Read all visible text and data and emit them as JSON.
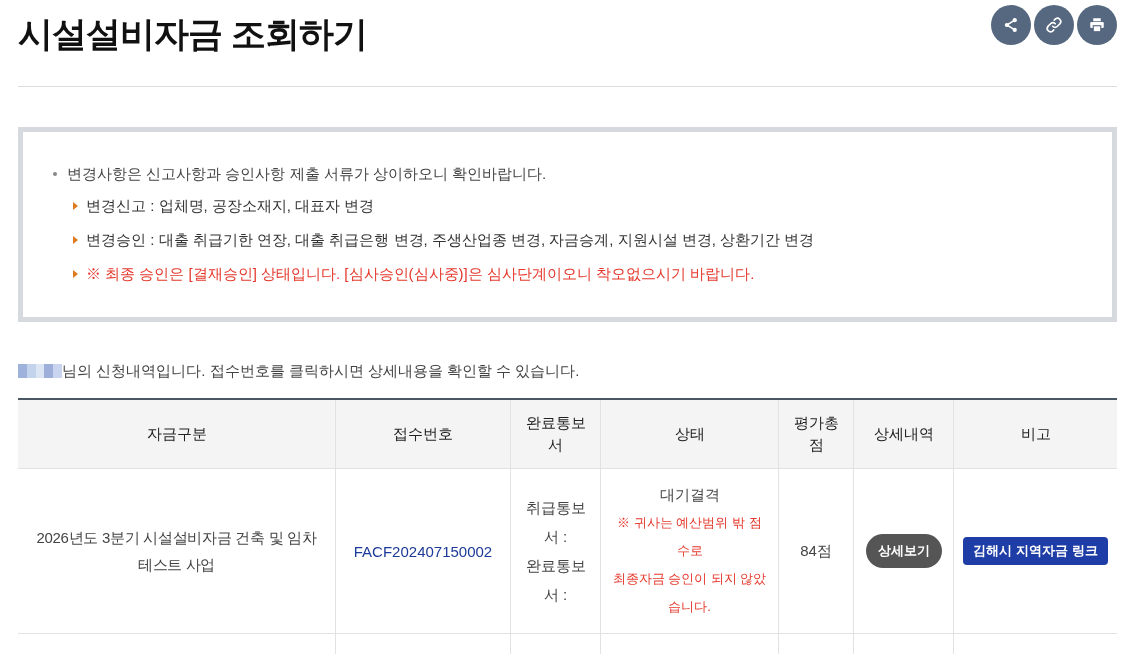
{
  "page": {
    "title": "시설설비자금 조회하기"
  },
  "notice": {
    "intro": "변경사항은 신고사항과 승인사항 제출 서류가 상이하오니 확인바랍니다.",
    "items": [
      {
        "kind": "normal",
        "text": "변경신고 : 업체명, 공장소재지, 대표자 변경"
      },
      {
        "kind": "normal",
        "text": "변경승인 : 대출 취급기한 연장, 대출 취급은행 변경, 주생산업종 변경, 자금승계, 지원시설 변경, 상환기간 변경"
      },
      {
        "kind": "warning",
        "text": "※ 최종 승인은 [결재승인] 상태입니다. [심사승인(심사중)]은 심사단계이오니 착오없으시기 바랍니다."
      }
    ]
  },
  "applicant_message": "님의 신청내역입니다. 접수번호를 클릭하시면 상세내용을 확인할 수 있습니다.",
  "table": {
    "columns": [
      "자금구분",
      "접수번호",
      "완료통보서",
      "상태",
      "평가총점",
      "상세내역",
      "비고"
    ],
    "rows": [
      {
        "fund_type": "2026년도 3분기 시설설비자금 건축 및 임차 테스트 사업",
        "receipt_no": "FACF202407150002",
        "notices": [
          "취급통보서 :",
          "완료통보서 :"
        ],
        "status": "대기결격",
        "status_note": [
          "※ 귀사는 예산범위 밖 점수로",
          "최종자금 승인이 되지 않았습니다."
        ],
        "score": "84점",
        "detail_button": "상세보기",
        "remark_link": "김해시 지역자금 링크"
      }
    ]
  }
}
